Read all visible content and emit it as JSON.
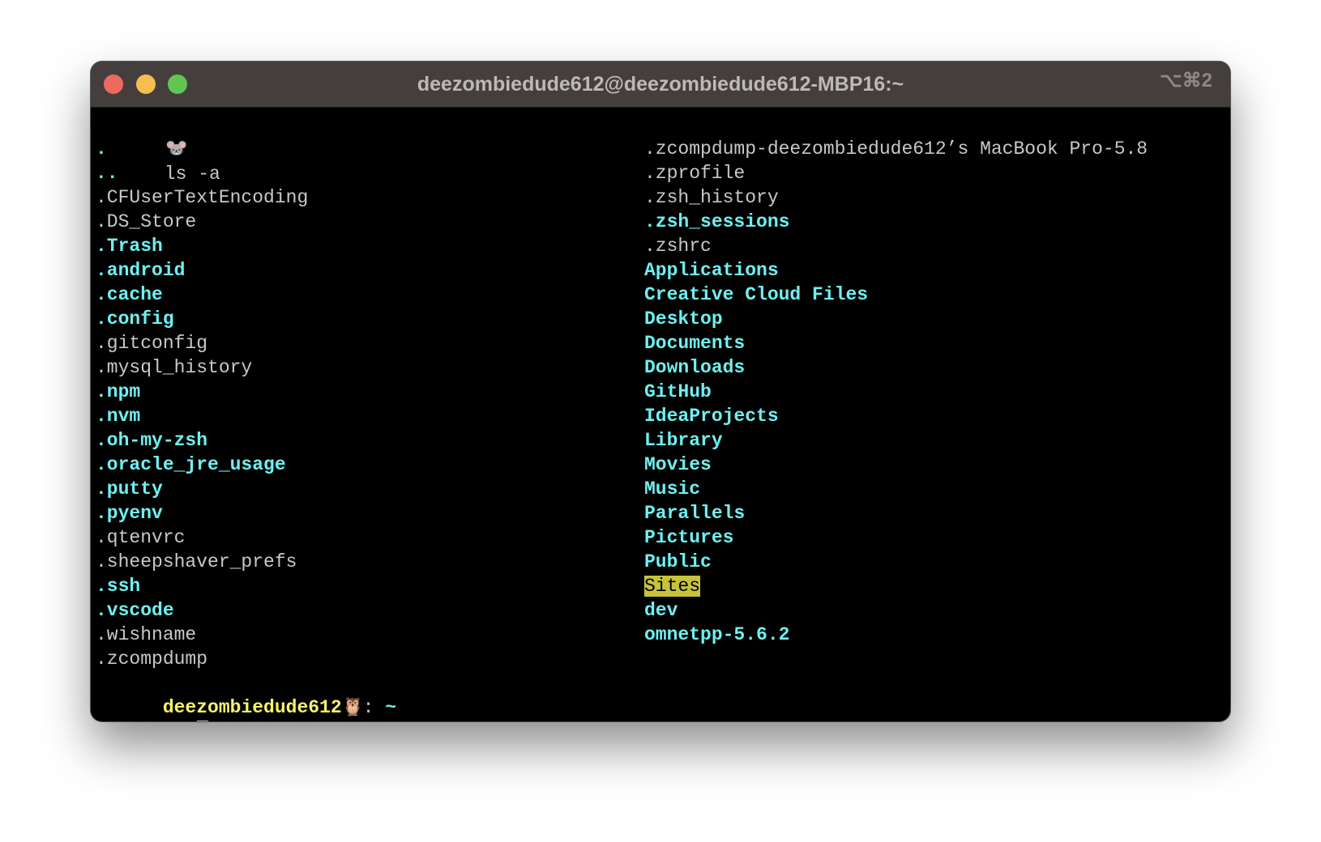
{
  "window": {
    "title": "deezombiedude612@deezombiedude612-MBP16:~",
    "shortcut": "⌥⌘2",
    "traffic_lights": {
      "close": "#ee6a5e",
      "minimize": "#f5be4f",
      "zoom": "#61c554"
    }
  },
  "terminal": {
    "prompt_icon": "mouse-face-emoji",
    "prompt_emoji": "🐭",
    "command": "ls -a",
    "column1": [
      {
        "name": ".",
        "kind": "dir"
      },
      {
        "name": "..",
        "kind": "dir"
      },
      {
        "name": ".CFUserTextEncoding",
        "kind": "file"
      },
      {
        "name": ".DS_Store",
        "kind": "file"
      },
      {
        "name": ".Trash",
        "kind": "dir"
      },
      {
        "name": ".android",
        "kind": "dir"
      },
      {
        "name": ".cache",
        "kind": "dir"
      },
      {
        "name": ".config",
        "kind": "dir"
      },
      {
        "name": ".gitconfig",
        "kind": "file"
      },
      {
        "name": ".mysql_history",
        "kind": "file"
      },
      {
        "name": ".npm",
        "kind": "dir"
      },
      {
        "name": ".nvm",
        "kind": "dir"
      },
      {
        "name": ".oh-my-zsh",
        "kind": "dir"
      },
      {
        "name": ".oracle_jre_usage",
        "kind": "dir"
      },
      {
        "name": ".putty",
        "kind": "dir"
      },
      {
        "name": ".pyenv",
        "kind": "dir"
      },
      {
        "name": ".qtenvrc",
        "kind": "file"
      },
      {
        "name": ".sheepshaver_prefs",
        "kind": "file"
      },
      {
        "name": ".ssh",
        "kind": "dir"
      },
      {
        "name": ".vscode",
        "kind": "dir"
      },
      {
        "name": ".wishname",
        "kind": "file"
      },
      {
        "name": ".zcompdump",
        "kind": "file"
      }
    ],
    "column2": [
      {
        "name": ".zcompdump-deezombiedude612’s MacBook Pro-5.8",
        "kind": "file"
      },
      {
        "name": ".zprofile",
        "kind": "file"
      },
      {
        "name": ".zsh_history",
        "kind": "file"
      },
      {
        "name": ".zsh_sessions",
        "kind": "dir"
      },
      {
        "name": ".zshrc",
        "kind": "file"
      },
      {
        "name": "Applications",
        "kind": "dir"
      },
      {
        "name": "Creative Cloud Files",
        "kind": "dir"
      },
      {
        "name": "Desktop",
        "kind": "dir"
      },
      {
        "name": "Documents",
        "kind": "dir"
      },
      {
        "name": "Downloads",
        "kind": "dir"
      },
      {
        "name": "GitHub",
        "kind": "dir"
      },
      {
        "name": "IdeaProjects",
        "kind": "dir"
      },
      {
        "name": "Library",
        "kind": "dir"
      },
      {
        "name": "Movies",
        "kind": "dir"
      },
      {
        "name": "Music",
        "kind": "dir"
      },
      {
        "name": "Parallels",
        "kind": "dir"
      },
      {
        "name": "Pictures",
        "kind": "dir"
      },
      {
        "name": "Public",
        "kind": "dir"
      },
      {
        "name": "Sites",
        "kind": "sticky"
      },
      {
        "name": "dev",
        "kind": "dir"
      },
      {
        "name": "omnetpp-5.6.2",
        "kind": "dir"
      }
    ],
    "status_line": {
      "user": "deezombiedude612",
      "owl_icon": "owl-emoji",
      "owl_emoji": "🦉",
      "separator": ": ",
      "path": "~"
    }
  }
}
